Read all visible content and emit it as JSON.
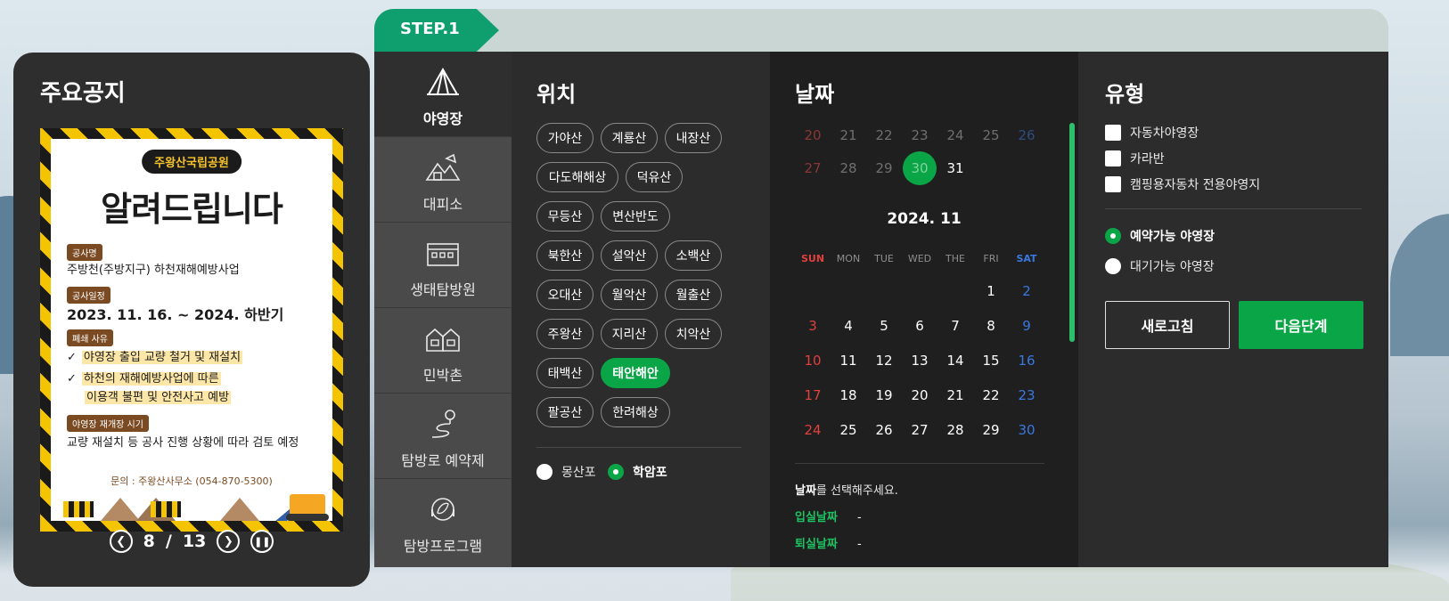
{
  "notice": {
    "title": "주요공지",
    "poster": {
      "pill": "주왕산국립공원",
      "headline": "알려드립니다",
      "tag1": "공사명",
      "text1": "주방천(주방지구) 하천재해예방사업",
      "tag2": "공사일정",
      "text2": "2023. 11. 16. ~ 2024. 하반기",
      "tag3": "폐쇄 사유",
      "check1": "야영장 출입 교량 철거 및 재설치",
      "check2a": "하천의 재해예방사업에 따른",
      "check2b": "이용객 불편 및 안전사고 예방",
      "tag4": "야영장 재개장 시기",
      "text4": "교량 재설치 등 공사 진행 상황에 따라 검토 예정",
      "contact": "문의 : 주왕산사무소 (054-870-5300)"
    },
    "pager": {
      "current": "8",
      "sep": "/",
      "total": "13"
    }
  },
  "step": {
    "label": "STEP.1"
  },
  "categories": [
    {
      "label": "야영장",
      "icon": "tent-icon",
      "active": true
    },
    {
      "label": "대피소",
      "icon": "shelter-icon",
      "active": false
    },
    {
      "label": "생태탐방원",
      "icon": "building-icon",
      "active": false
    },
    {
      "label": "민박촌",
      "icon": "houses-icon",
      "active": false
    },
    {
      "label": "탐방로 예약제",
      "icon": "trail-icon",
      "active": false
    },
    {
      "label": "탐방프로그램",
      "icon": "program-icon",
      "active": false
    }
  ],
  "location": {
    "title": "위치",
    "chips": [
      "가야산",
      "계룡산",
      "내장산",
      "다도해해상",
      "덕유산",
      "무등산",
      "변산반도",
      "북한산",
      "설악산",
      "소백산",
      "오대산",
      "월악산",
      "월출산",
      "주왕산",
      "지리산",
      "치악산",
      "태백산",
      "태안해안",
      "팔공산",
      "한려해상"
    ],
    "selected": "태안해안",
    "sub_options": [
      {
        "label": "몽산포",
        "checked": false
      },
      {
        "label": "학암포",
        "checked": true
      }
    ]
  },
  "date": {
    "title": "날짜",
    "prev_rows": [
      [
        "20",
        "21",
        "22",
        "23",
        "24",
        "25",
        "26"
      ],
      [
        "27",
        "28",
        "29",
        "30",
        "31"
      ]
    ],
    "selected_day": "30",
    "month_label": "2024. 11",
    "weekdays": [
      "SUN",
      "MON",
      "TUE",
      "WED",
      "THE",
      "FRI",
      "SAT"
    ],
    "weeks": [
      [
        "",
        "",
        "",
        "",
        "",
        "1",
        "2"
      ],
      [
        "3",
        "4",
        "5",
        "6",
        "7",
        "8",
        "9"
      ],
      [
        "10",
        "11",
        "12",
        "13",
        "14",
        "15",
        "16"
      ],
      [
        "17",
        "18",
        "19",
        "20",
        "21",
        "22",
        "23"
      ],
      [
        "24",
        "25",
        "26",
        "27",
        "28",
        "29",
        "30"
      ]
    ],
    "prompt_strong": "날짜",
    "prompt_rest": "를 선택해주세요.",
    "checkin_label": "입실날짜",
    "checkin_value": "-",
    "checkout_label": "퇴실날짜",
    "checkout_value": "-"
  },
  "type": {
    "title": "유형",
    "checkboxes": [
      "자동차야영장",
      "카라반",
      "캠핑용자동차 전용야영지"
    ],
    "radios": [
      {
        "label": "예약가능 야영장",
        "checked": true
      },
      {
        "label": "대기가능 야영장",
        "checked": false
      }
    ],
    "refresh_label": "새로고침",
    "next_label": "다음단계"
  },
  "colors": {
    "accent": "#0aa546",
    "step": "#0f9f6e",
    "sun": "#e0403e",
    "sat": "#3a78e0"
  }
}
